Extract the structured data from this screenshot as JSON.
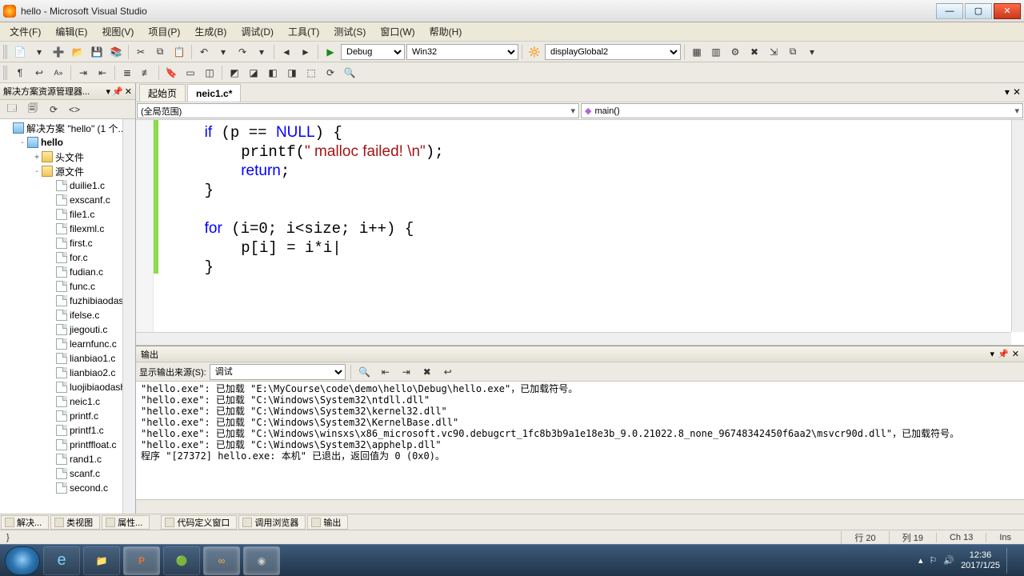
{
  "window": {
    "title": "hello - Microsoft Visual Studio"
  },
  "menu": [
    "文件(F)",
    "编辑(E)",
    "视图(V)",
    "项目(P)",
    "生成(B)",
    "调试(D)",
    "工具(T)",
    "测试(S)",
    "窗口(W)",
    "帮助(H)"
  ],
  "toolbar1": {
    "config": "Debug",
    "platform": "Win32",
    "symbol": "displayGlobal2"
  },
  "sidebar": {
    "title": "解决方案资源管理器...",
    "solution_label": "解决方案 \"hello\" (1 个...",
    "project": "hello",
    "folders": {
      "headers": "头文件",
      "sources": "源文件"
    },
    "files": [
      "duilie1.c",
      "exscanf.c",
      "file1.c",
      "filexml.c",
      "first.c",
      "for.c",
      "fudian.c",
      "func.c",
      "fuzhibiaodas...",
      "ifelse.c",
      "jiegouti.c",
      "learnfunc.c",
      "lianbiao1.c",
      "lianbiao2.c",
      "luojibiaodash...",
      "neic1.c",
      "printf.c",
      "printf1.c",
      "printffloat.c",
      "rand1.c",
      "scanf.c",
      "second.c"
    ]
  },
  "tabs": {
    "start": "起始页",
    "active": "neic1.c*"
  },
  "scope": {
    "left": "(全局范围)",
    "right": "main()"
  },
  "code": {
    "lines": [
      {
        "indent": 1,
        "parts": [
          {
            "t": "if",
            "c": "kw"
          },
          {
            "t": " (p == "
          },
          {
            "t": "NULL",
            "c": "kw"
          },
          {
            "t": ") {"
          }
        ]
      },
      {
        "indent": 2,
        "parts": [
          {
            "t": "printf("
          },
          {
            "t": "\" malloc failed! \\n\"",
            "c": "str"
          },
          {
            "t": ");"
          }
        ]
      },
      {
        "indent": 2,
        "parts": [
          {
            "t": "return",
            "c": "kw"
          },
          {
            "t": ";"
          }
        ]
      },
      {
        "indent": 1,
        "parts": [
          {
            "t": "}"
          }
        ]
      },
      {
        "indent": 0,
        "parts": [
          {
            "t": ""
          }
        ]
      },
      {
        "indent": 1,
        "parts": [
          {
            "t": "for",
            "c": "kw"
          },
          {
            "t": " (i=0; i<size; i++) {"
          }
        ]
      },
      {
        "indent": 2,
        "parts": [
          {
            "t": "p[i] = i*i|"
          }
        ]
      },
      {
        "indent": 1,
        "parts": [
          {
            "t": "}"
          }
        ]
      }
    ]
  },
  "output": {
    "title": "输出",
    "source_label": "显示输出来源(S):",
    "source_value": "调试",
    "lines": [
      "\"hello.exe\": 已加载 \"E:\\MyCourse\\code\\demo\\hello\\Debug\\hello.exe\"，已加载符号。",
      "\"hello.exe\": 已加载 \"C:\\Windows\\System32\\ntdll.dll\"",
      "\"hello.exe\": 已加载 \"C:\\Windows\\System32\\kernel32.dll\"",
      "\"hello.exe\": 已加载 \"C:\\Windows\\System32\\KernelBase.dll\"",
      "\"hello.exe\": 已加载 \"C:\\Windows\\winsxs\\x86_microsoft.vc90.debugcrt_1fc8b3b9a1e18e3b_9.0.21022.8_none_96748342450f6aa2\\msvcr90d.dll\"，已加载符号。",
      "\"hello.exe\": 已加载 \"C:\\Windows\\System32\\apphelp.dll\"",
      "程序 \"[27372] hello.exe: 本机\" 已退出，返回值为 0 (0x0)。"
    ]
  },
  "bottom_tabs": {
    "left": [
      "解决...",
      "类视图",
      "属性..."
    ],
    "right": [
      "代码定义窗口",
      "调用浏览器",
      "输出"
    ]
  },
  "status": {
    "line": "行 20",
    "col": "列 19",
    "ch": "Ch 13",
    "ins": "Ins"
  },
  "taskbar": {
    "time": "12:36",
    "date": "2017/1/25"
  }
}
